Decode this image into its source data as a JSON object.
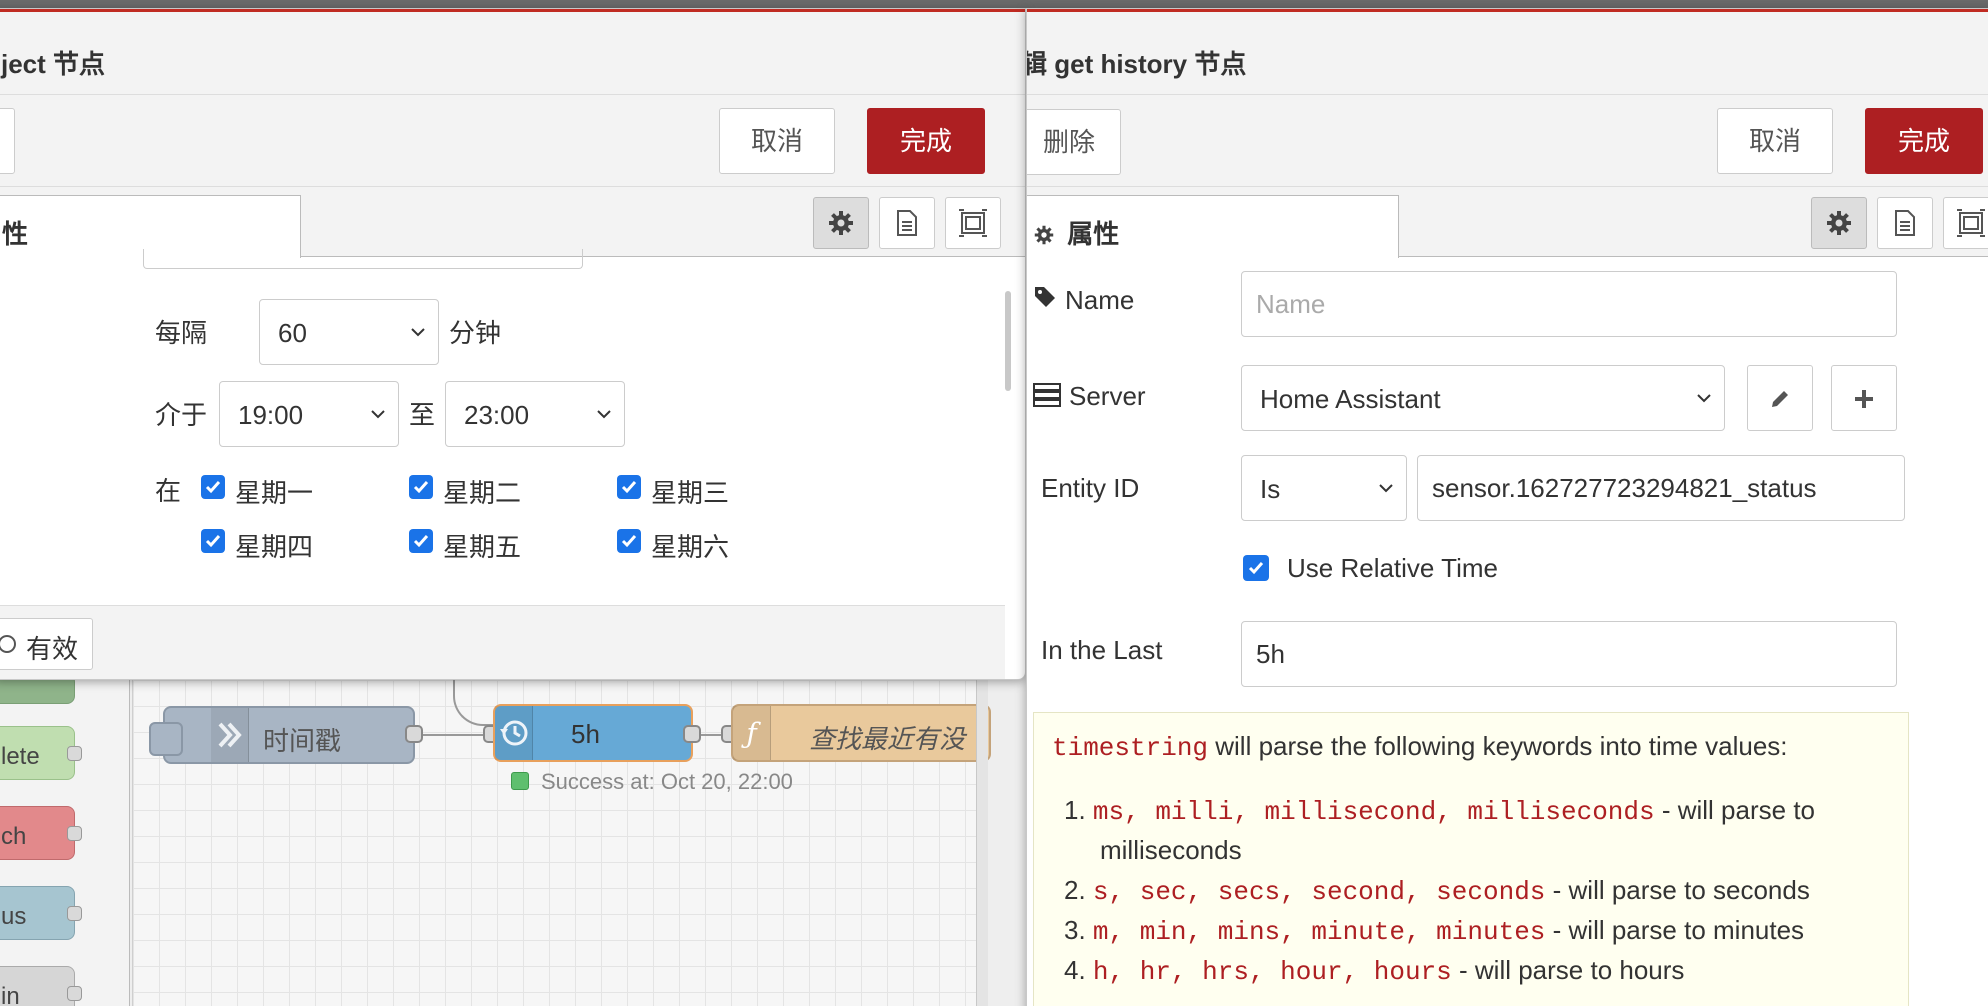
{
  "colors": {
    "primary_button": "#ad1f22",
    "checkbox": "#1a73e8",
    "title_border": "#c02b22"
  },
  "left_dialog": {
    "title": "ject 节点",
    "cancel_label": "取消",
    "done_label": "完成",
    "tab_label": "性",
    "repeat": {
      "every_label": "每隔",
      "every_value": "60",
      "every_unit": "分钟",
      "between_label": "介于",
      "from_value": "19:00",
      "to_label": "至",
      "to_value": "23:00",
      "on_label": "在",
      "days": [
        "星期一",
        "星期二",
        "星期三",
        "星期四",
        "星期五",
        "星期六"
      ]
    },
    "footer_toggle_label": "有效"
  },
  "right_dialog": {
    "title": "辑 get history 节点",
    "delete_label": "删除",
    "cancel_label": "取消",
    "done_label": "完成",
    "tab_label": "属性",
    "name": {
      "label": "Name",
      "placeholder": "Name"
    },
    "server": {
      "label": "Server",
      "value": "Home Assistant"
    },
    "entity": {
      "label": "Entity ID",
      "operator": "Is",
      "value": "sensor.162727723294821_status"
    },
    "relative_time": {
      "label": "Use Relative Time",
      "checked": true
    },
    "last": {
      "label": "In the Last",
      "value": "5h"
    },
    "help": {
      "intro_code": "timestring",
      "intro_text": " will parse the following keywords into time values:",
      "items": [
        {
          "num": "1.",
          "code": "ms, milli, millisecond, milliseconds",
          "text": " - will parse to",
          "cont": "milliseconds"
        },
        {
          "num": "2.",
          "code": "s, sec, secs, second, seconds",
          "text": " - will parse to seconds"
        },
        {
          "num": "3.",
          "code": "m, min, mins, minute, minutes",
          "text": " - will parse to minutes"
        },
        {
          "num": "4.",
          "code": "h, hr, hrs, hour, hours",
          "text": " - will parse to hours"
        }
      ]
    }
  },
  "canvas": {
    "palette_nodes": [
      "lete",
      "ch",
      "us",
      "in"
    ],
    "inject_node_label": "时间戳",
    "history_node_label": "5h",
    "history_status": "Success at: Oct 20, 22:00",
    "function_node_label": "查找最近有没"
  }
}
